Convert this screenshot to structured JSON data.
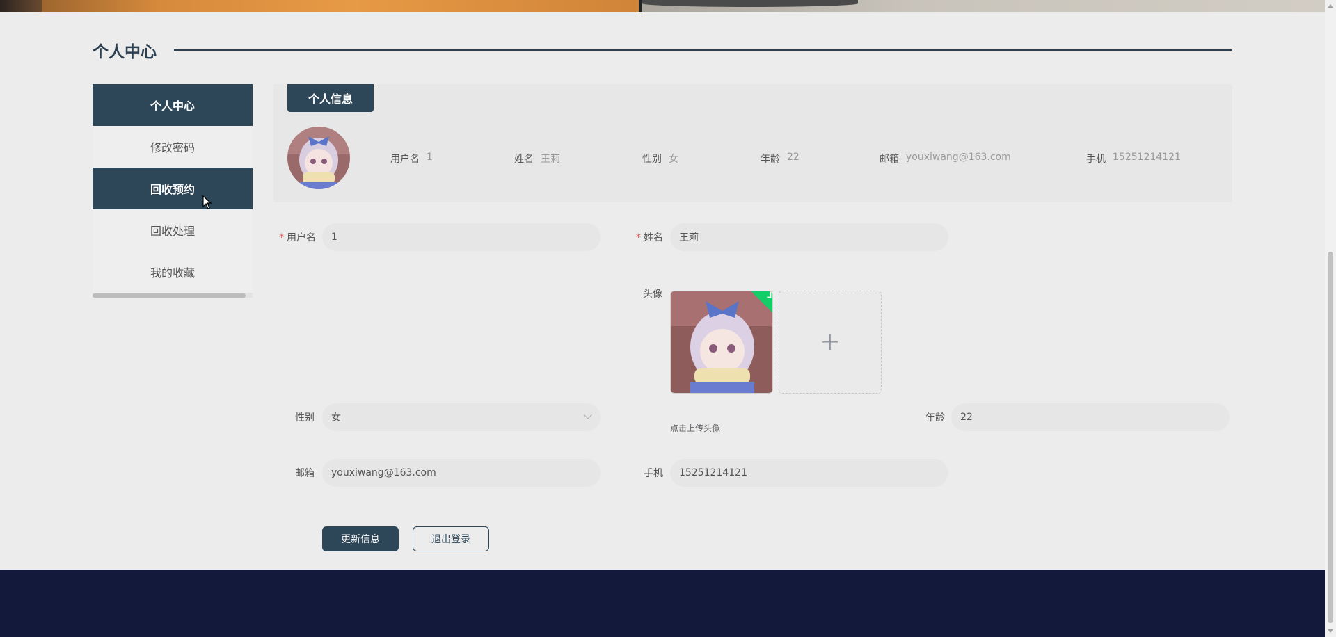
{
  "section": {
    "title": "个人中心"
  },
  "sidebar": {
    "items": [
      {
        "label": "个人中心",
        "active": true
      },
      {
        "label": "修改密码",
        "active": false
      },
      {
        "label": "回收预约",
        "active": true
      },
      {
        "label": "回收处理",
        "active": false
      },
      {
        "label": "我的收藏",
        "active": false
      }
    ]
  },
  "info_card": {
    "tab_label": "个人信息",
    "fields": [
      {
        "key": "用户名",
        "value": "1"
      },
      {
        "key": "姓名",
        "value": "王莉"
      },
      {
        "key": "性别",
        "value": "女"
      },
      {
        "key": "年龄",
        "value": "22"
      },
      {
        "key": "邮箱",
        "value": "youxiwang@163.com"
      },
      {
        "key": "手机",
        "value": "15251214121"
      }
    ]
  },
  "form": {
    "username": {
      "label": "用户名",
      "value": "1",
      "required": true
    },
    "name": {
      "label": "姓名",
      "value": "王莉",
      "required": true
    },
    "avatar": {
      "label": "头像",
      "hint": "点击上传头像",
      "add_symbol": "+"
    },
    "gender": {
      "label": "性别",
      "value": "女"
    },
    "age": {
      "label": "年龄",
      "value": "22"
    },
    "email": {
      "label": "邮箱",
      "value": "youxiwang@163.com"
    },
    "phone": {
      "label": "手机",
      "value": "15251214121"
    },
    "required_mark": "*"
  },
  "buttons": {
    "update_label": "更新信息",
    "logout_label": "退出登录"
  },
  "colors": {
    "primary": "#2d4658",
    "footer": "#12193a",
    "success": "#13ce66"
  }
}
